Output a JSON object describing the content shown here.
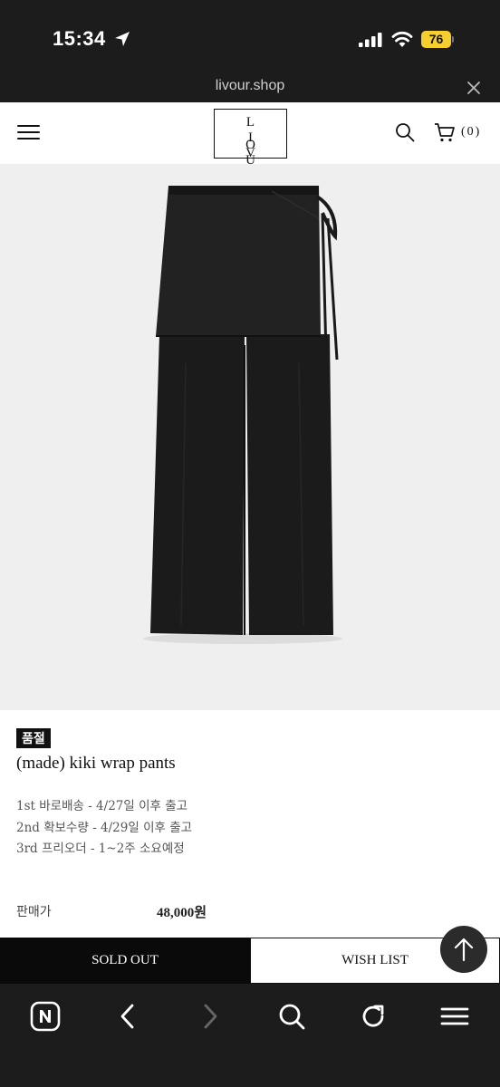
{
  "status_bar": {
    "time": "15:34",
    "battery": "76"
  },
  "url_bar": {
    "url": "livour.shop"
  },
  "header": {
    "logo_line1": "L I V",
    "logo_line2": "O U R",
    "cart_count": "(0)"
  },
  "product": {
    "badge": "품절",
    "name": "(made) kiki wrap pants",
    "shipping": [
      "1st 바로배송 - 4/27일 이후 출고",
      "2nd 확보수량 - 4/29일 이후 출고",
      "3rd 프리오더 - 1~2주 소요예정"
    ],
    "price_label": "판매가",
    "price": "48,000원"
  },
  "actions": {
    "sold_out": "SOLD OUT",
    "wish_list": "WISH LIST"
  },
  "icons": {
    "status": [
      "location-arrow-icon",
      "signal-icon",
      "wifi-icon",
      "battery-icon"
    ],
    "header": [
      "menu-icon",
      "search-icon",
      "cart-icon"
    ],
    "toolbar": [
      "naver-n-icon",
      "back-icon",
      "forward-icon",
      "search-icon",
      "reload-icon",
      "menu-icon"
    ]
  },
  "colors": {
    "badge_bg": "#111111",
    "battery": "#f6cf2f",
    "chrome": "#1c1c1c",
    "image_bg": "#efefef"
  }
}
